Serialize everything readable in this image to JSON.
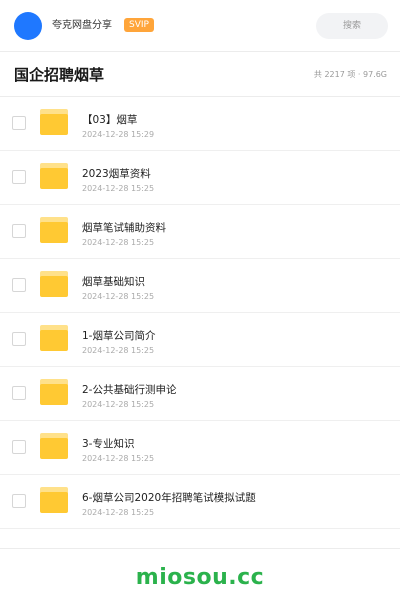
{
  "top_bar": {
    "username": "夸克网盘分享",
    "badge": "SVIP",
    "search_label": "搜索",
    "colors": {
      "avatar": "#1f78ff",
      "badge": "#ffa53a"
    }
  },
  "header": {
    "title": "国企招聘烟草",
    "summary": "共 2217 项 · 97.6G"
  },
  "files": [
    {
      "name": "【03】烟草",
      "date": "2024-12-28 15:29",
      "icon": "folder-icon"
    },
    {
      "name": "2023烟草资料",
      "date": "2024-12-28 15:25",
      "icon": "folder-icon"
    },
    {
      "name": "烟草笔试辅助资料",
      "date": "2024-12-28 15:25",
      "icon": "folder-icon"
    },
    {
      "name": "烟草基础知识",
      "date": "2024-12-28 15:25",
      "icon": "folder-icon"
    },
    {
      "name": "1-烟草公司简介",
      "date": "2024-12-28 15:25",
      "icon": "folder-icon"
    },
    {
      "name": "2-公共基础行测申论",
      "date": "2024-12-28 15:25",
      "icon": "folder-icon"
    },
    {
      "name": "3-专业知识",
      "date": "2024-12-28 15:25",
      "icon": "folder-icon"
    },
    {
      "name": "6-烟草公司2020年招聘笔试模拟试题",
      "date": "2024-12-28 15:25",
      "icon": "folder-icon"
    }
  ],
  "watermark": "miosou.cc"
}
